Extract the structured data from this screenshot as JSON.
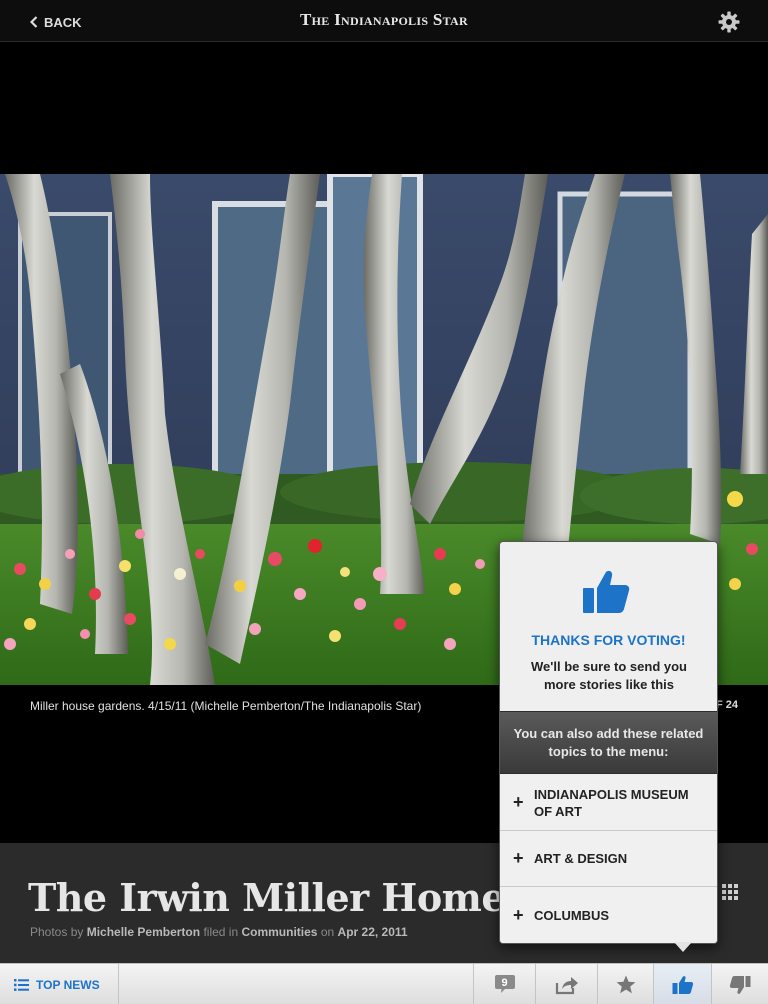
{
  "header": {
    "back_label": "BACK",
    "masthead": "The Indianapolis Star"
  },
  "photo": {
    "caption": "Miller house gardens. 4/15/11 (Michelle Pemberton/The Indianapolis Star)",
    "counter_visible": "F 24"
  },
  "story": {
    "title": "The Irwin Miller Home G",
    "byline_prefix": "Photos by",
    "author": "Michelle Pemberton",
    "filed_in": "filed in",
    "section": "Communities",
    "on": "on",
    "date": "Apr 22, 2011"
  },
  "popover": {
    "thanks": "THANKS FOR VOTING!",
    "sub": "We'll be sure to send you more stories like this",
    "related": "You can also add these related topics to the menu:",
    "topics": [
      {
        "label": "INDIANAPOLIS MUSEUM OF ART"
      },
      {
        "label": "ART & DESIGN"
      },
      {
        "label": "COLUMBUS"
      }
    ]
  },
  "toolbar": {
    "top_news_label": "TOP NEWS",
    "comment_count": "9"
  },
  "colors": {
    "accent": "#1d73c8",
    "title_band": "#2b2b2b",
    "toolbar": "#e8e8e8"
  }
}
